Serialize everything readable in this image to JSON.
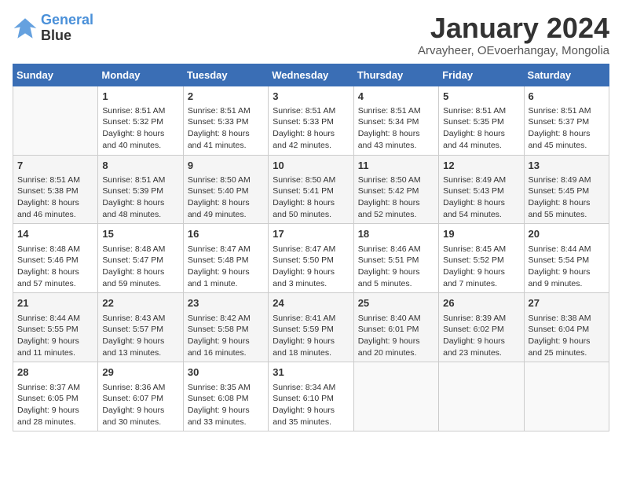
{
  "logo": {
    "line1": "General",
    "line2": "Blue"
  },
  "title": "January 2024",
  "subtitle": "Arvayheer, OEvoerhangay, Mongolia",
  "days_of_week": [
    "Sunday",
    "Monday",
    "Tuesday",
    "Wednesday",
    "Thursday",
    "Friday",
    "Saturday"
  ],
  "weeks": [
    [
      {
        "day": "",
        "info": ""
      },
      {
        "day": "1",
        "info": "Sunrise: 8:51 AM\nSunset: 5:32 PM\nDaylight: 8 hours\nand 40 minutes."
      },
      {
        "day": "2",
        "info": "Sunrise: 8:51 AM\nSunset: 5:33 PM\nDaylight: 8 hours\nand 41 minutes."
      },
      {
        "day": "3",
        "info": "Sunrise: 8:51 AM\nSunset: 5:33 PM\nDaylight: 8 hours\nand 42 minutes."
      },
      {
        "day": "4",
        "info": "Sunrise: 8:51 AM\nSunset: 5:34 PM\nDaylight: 8 hours\nand 43 minutes."
      },
      {
        "day": "5",
        "info": "Sunrise: 8:51 AM\nSunset: 5:35 PM\nDaylight: 8 hours\nand 44 minutes."
      },
      {
        "day": "6",
        "info": "Sunrise: 8:51 AM\nSunset: 5:37 PM\nDaylight: 8 hours\nand 45 minutes."
      }
    ],
    [
      {
        "day": "7",
        "info": "Sunrise: 8:51 AM\nSunset: 5:38 PM\nDaylight: 8 hours\nand 46 minutes."
      },
      {
        "day": "8",
        "info": "Sunrise: 8:51 AM\nSunset: 5:39 PM\nDaylight: 8 hours\nand 48 minutes."
      },
      {
        "day": "9",
        "info": "Sunrise: 8:50 AM\nSunset: 5:40 PM\nDaylight: 8 hours\nand 49 minutes."
      },
      {
        "day": "10",
        "info": "Sunrise: 8:50 AM\nSunset: 5:41 PM\nDaylight: 8 hours\nand 50 minutes."
      },
      {
        "day": "11",
        "info": "Sunrise: 8:50 AM\nSunset: 5:42 PM\nDaylight: 8 hours\nand 52 minutes."
      },
      {
        "day": "12",
        "info": "Sunrise: 8:49 AM\nSunset: 5:43 PM\nDaylight: 8 hours\nand 54 minutes."
      },
      {
        "day": "13",
        "info": "Sunrise: 8:49 AM\nSunset: 5:45 PM\nDaylight: 8 hours\nand 55 minutes."
      }
    ],
    [
      {
        "day": "14",
        "info": "Sunrise: 8:48 AM\nSunset: 5:46 PM\nDaylight: 8 hours\nand 57 minutes."
      },
      {
        "day": "15",
        "info": "Sunrise: 8:48 AM\nSunset: 5:47 PM\nDaylight: 8 hours\nand 59 minutes."
      },
      {
        "day": "16",
        "info": "Sunrise: 8:47 AM\nSunset: 5:48 PM\nDaylight: 9 hours\nand 1 minute."
      },
      {
        "day": "17",
        "info": "Sunrise: 8:47 AM\nSunset: 5:50 PM\nDaylight: 9 hours\nand 3 minutes."
      },
      {
        "day": "18",
        "info": "Sunrise: 8:46 AM\nSunset: 5:51 PM\nDaylight: 9 hours\nand 5 minutes."
      },
      {
        "day": "19",
        "info": "Sunrise: 8:45 AM\nSunset: 5:52 PM\nDaylight: 9 hours\nand 7 minutes."
      },
      {
        "day": "20",
        "info": "Sunrise: 8:44 AM\nSunset: 5:54 PM\nDaylight: 9 hours\nand 9 minutes."
      }
    ],
    [
      {
        "day": "21",
        "info": "Sunrise: 8:44 AM\nSunset: 5:55 PM\nDaylight: 9 hours\nand 11 minutes."
      },
      {
        "day": "22",
        "info": "Sunrise: 8:43 AM\nSunset: 5:57 PM\nDaylight: 9 hours\nand 13 minutes."
      },
      {
        "day": "23",
        "info": "Sunrise: 8:42 AM\nSunset: 5:58 PM\nDaylight: 9 hours\nand 16 minutes."
      },
      {
        "day": "24",
        "info": "Sunrise: 8:41 AM\nSunset: 5:59 PM\nDaylight: 9 hours\nand 18 minutes."
      },
      {
        "day": "25",
        "info": "Sunrise: 8:40 AM\nSunset: 6:01 PM\nDaylight: 9 hours\nand 20 minutes."
      },
      {
        "day": "26",
        "info": "Sunrise: 8:39 AM\nSunset: 6:02 PM\nDaylight: 9 hours\nand 23 minutes."
      },
      {
        "day": "27",
        "info": "Sunrise: 8:38 AM\nSunset: 6:04 PM\nDaylight: 9 hours\nand 25 minutes."
      }
    ],
    [
      {
        "day": "28",
        "info": "Sunrise: 8:37 AM\nSunset: 6:05 PM\nDaylight: 9 hours\nand 28 minutes."
      },
      {
        "day": "29",
        "info": "Sunrise: 8:36 AM\nSunset: 6:07 PM\nDaylight: 9 hours\nand 30 minutes."
      },
      {
        "day": "30",
        "info": "Sunrise: 8:35 AM\nSunset: 6:08 PM\nDaylight: 9 hours\nand 33 minutes."
      },
      {
        "day": "31",
        "info": "Sunrise: 8:34 AM\nSunset: 6:10 PM\nDaylight: 9 hours\nand 35 minutes."
      },
      {
        "day": "",
        "info": ""
      },
      {
        "day": "",
        "info": ""
      },
      {
        "day": "",
        "info": ""
      }
    ]
  ]
}
